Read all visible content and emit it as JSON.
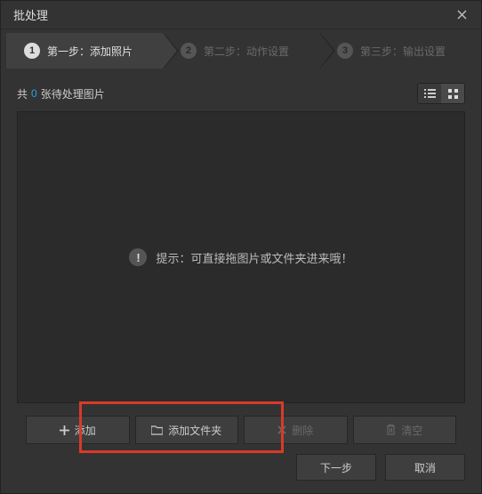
{
  "window": {
    "title": "批处理"
  },
  "steps": {
    "s1": {
      "num": "1",
      "label": "第一步：添加照片"
    },
    "s2": {
      "num": "2",
      "label": "第二步：动作设置"
    },
    "s3": {
      "num": "3",
      "label": "第三步：输出设置"
    }
  },
  "count": {
    "prefix": "共",
    "value": "0",
    "suffix": "张待处理图片"
  },
  "hint": {
    "text": "提示：可直接拖图片或文件夹进来哦！"
  },
  "actions": {
    "add": "添加",
    "add_folder": "添加文件夹",
    "delete": "删除",
    "clear": "清空"
  },
  "footer": {
    "next": "下一步",
    "cancel": "取消"
  }
}
